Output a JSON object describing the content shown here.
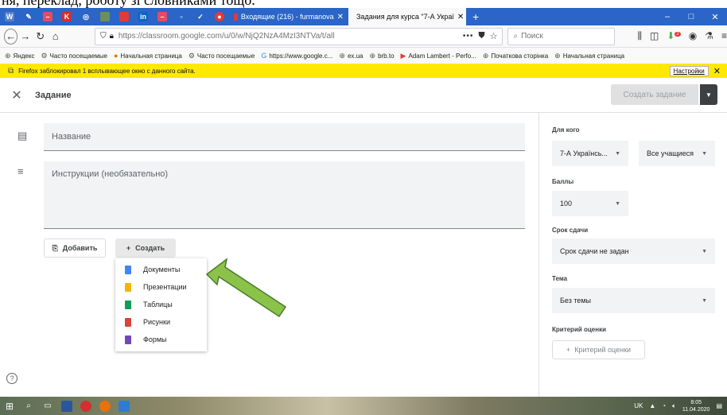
{
  "doc_caption": "ня, переклад, роботу зі словниками тощо.",
  "browser": {
    "tabs": [
      {
        "label": "Входящие (216) - furmanova",
        "close": "✕"
      },
      {
        "label": "Задания для курса \"7-А Украї",
        "close": "✕"
      }
    ],
    "new_tab": "+",
    "window_controls": [
      "–",
      "□",
      "✕"
    ],
    "url": "https://classroom.google.com/u/0/w/NjQ2NzA4MzI3NTVa/t/all",
    "url_actions": "•••",
    "search_placeholder": "Поиск",
    "bookmarks": [
      "Яндекс",
      "Часто посещаемые",
      "Начальная страница",
      "Часто посещаемые",
      "https://www.google.c...",
      "ex.ua",
      "brb.to",
      "Adam Lambert - Perfo...",
      "Початкова сторінка",
      "Начальная страница"
    ],
    "notice": {
      "text": "Firefox заблокировал 1 всплывающее окно с данного сайта.",
      "settings_label": "Настройки",
      "close": "✕"
    },
    "badge": "2"
  },
  "header": {
    "close": "✕",
    "title": "Задание",
    "create_button": "Создать задание",
    "dropdown": "▼"
  },
  "form": {
    "title_placeholder": "Название",
    "instructions_placeholder": "Инструкции (необязательно)",
    "add_button": "Добавить",
    "create_button": "Создать",
    "plus": "+"
  },
  "create_menu": [
    {
      "label": "Документы",
      "color": "#4285f4"
    },
    {
      "label": "Презентации",
      "color": "#f4b400"
    },
    {
      "label": "Таблицы",
      "color": "#0f9d58"
    },
    {
      "label": "Рисунки",
      "color": "#db4437"
    },
    {
      "label": "Формы",
      "color": "#7248b9"
    }
  ],
  "arrow_color": "#8bc34a",
  "side": {
    "for_whom_label": "Для кого",
    "class_value": "7-А Українсь...",
    "students_value": "Все учащиеся",
    "points_label": "Баллы",
    "points_value": "100",
    "due_label": "Срок сдачи",
    "due_value": "Срок сдачи не задан",
    "topic_label": "Тема",
    "topic_value": "Без темы",
    "rubric_label": "Критерий оценки",
    "rubric_button": "Критерий оценки",
    "caret": "▼"
  },
  "taskbar": {
    "lang": "UK",
    "time": "8:05",
    "date": "11.04.2020"
  }
}
